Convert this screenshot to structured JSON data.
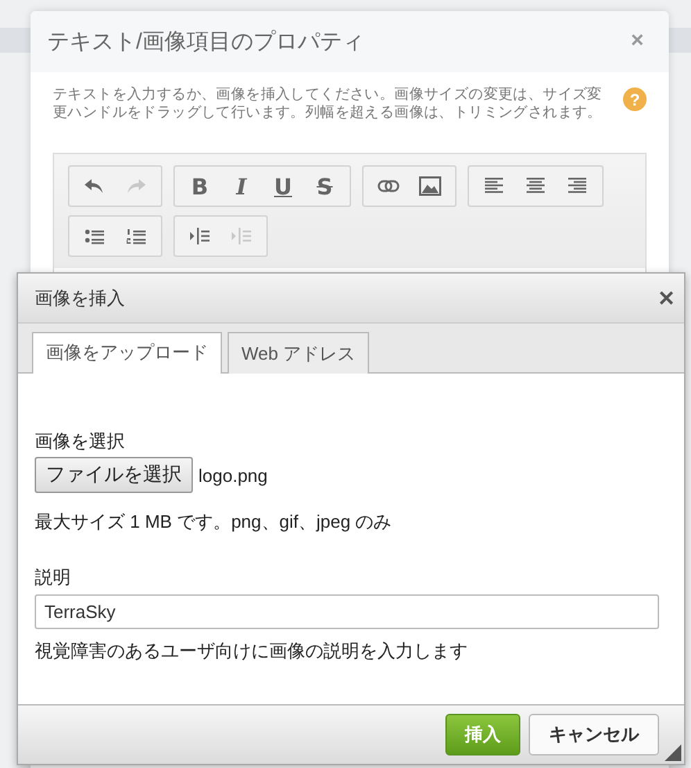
{
  "properties_dialog": {
    "title": "テキスト/画像項目のプロパティ",
    "close": "×",
    "description": "テキストを入力するか、画像を挿入してください。画像サイズの変更は、サイズ変更ハンドルをドラッグして行います。列幅を超える画像は、トリミングされます。",
    "help": "?",
    "toolbar": [
      [
        [
          {
            "kind": "undo",
            "disabled": false
          },
          {
            "kind": "redo",
            "disabled": true
          }
        ],
        [
          {
            "kind": "bold",
            "label": "B",
            "disabled": false
          },
          {
            "kind": "italic",
            "label": "I",
            "disabled": false
          },
          {
            "kind": "underline",
            "label": "U",
            "disabled": false
          },
          {
            "kind": "strike",
            "label": "S",
            "disabled": false
          }
        ],
        [
          {
            "kind": "link",
            "disabled": false
          },
          {
            "kind": "image",
            "disabled": false
          }
        ],
        [
          {
            "kind": "align-left",
            "disabled": false
          },
          {
            "kind": "align-center",
            "disabled": false
          },
          {
            "kind": "align-right",
            "disabled": false
          }
        ]
      ],
      [
        [
          {
            "kind": "bullets",
            "disabled": false
          },
          {
            "kind": "numbers",
            "disabled": false
          }
        ],
        [
          {
            "kind": "indent",
            "disabled": false
          },
          {
            "kind": "outdent",
            "disabled": true
          }
        ]
      ]
    ]
  },
  "insert_dialog": {
    "title": "画像を挿入",
    "close": "✕",
    "tabs": [
      {
        "label": "画像をアップロード",
        "selected": true
      },
      {
        "label": "Web アドレス",
        "selected": false
      }
    ],
    "file_label": "画像を選択",
    "file_button": "ファイルを選択",
    "file_name": "logo.png",
    "size_note": "最大サイズ 1 MB です。png、gif、jpeg のみ",
    "description_label": "説明",
    "description_value": "TerraSky",
    "description_hint": "視覚障害のあるユーザ向けに画像の説明を入力します",
    "buttons": [
      {
        "kind": "primary",
        "label": "挿入"
      },
      {
        "kind": "secondary",
        "label": "キャンセル"
      }
    ]
  }
}
